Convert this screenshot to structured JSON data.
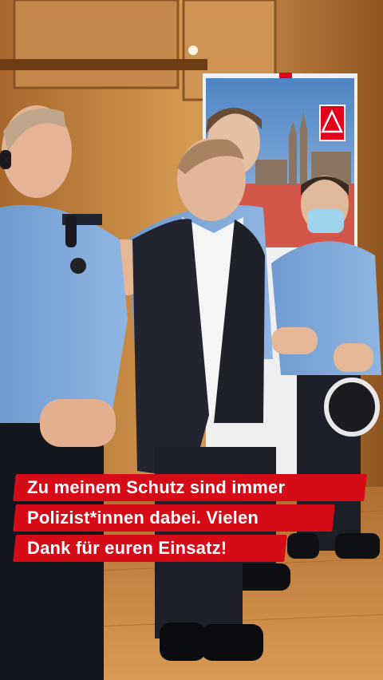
{
  "scene": {
    "banner_logo": "ig-metall-triangle-logo",
    "colors": {
      "wall": "#c8833e",
      "floor": "#c9803f",
      "police_shirt": "#7ea8d8",
      "suit": "#22252f",
      "caption_red": "#d50b17"
    }
  },
  "caption": {
    "line1": "Zu meinem Schutz sind immer",
    "line2": "Polizist*innen dabei. Vielen",
    "line3": "Dank für euren Einsatz!"
  }
}
